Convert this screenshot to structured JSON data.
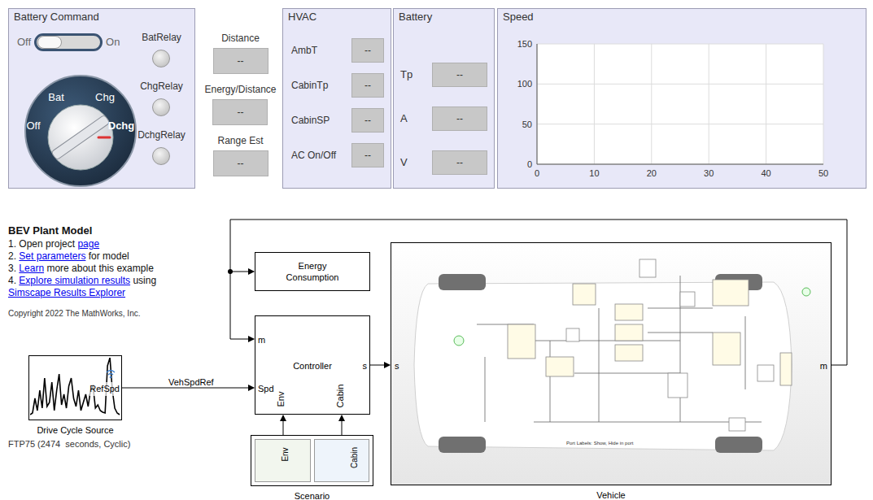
{
  "dashboard": {
    "battery_command": {
      "title": "Battery Command",
      "switch": {
        "off_label": "Off",
        "on_label": "On",
        "on": false
      },
      "knob": [
        {
          "label": "Bat",
          "selected": false
        },
        {
          "label": "Chg",
          "selected": false
        },
        {
          "label": "Off",
          "selected": false
        },
        {
          "label": "Dchg",
          "selected": true
        }
      ],
      "lamps": [
        {
          "label": "BatRelay",
          "on": false
        },
        {
          "label": "ChgRelay",
          "on": false
        },
        {
          "label": "DchgRelay",
          "on": false
        }
      ]
    },
    "readouts": [
      {
        "label": "Distance",
        "value": "--"
      },
      {
        "label": "Energy/Distance",
        "value": "--"
      },
      {
        "label": "Range Est",
        "value": "--"
      }
    ],
    "hvac": {
      "title": "HVAC",
      "rows": [
        {
          "label": "AmbT",
          "value": "--"
        },
        {
          "label": "CabinTp",
          "value": "--"
        },
        {
          "label": "CabinSP",
          "value": "--"
        },
        {
          "label": "AC On/Off",
          "value": "--"
        }
      ]
    },
    "battery": {
      "title": "Battery",
      "rows": [
        {
          "label": "Tp",
          "value": "--"
        },
        {
          "label": "A",
          "value": "--"
        },
        {
          "label": "V",
          "value": "--"
        }
      ]
    },
    "speed": {
      "title": "Speed",
      "y_ticks": [
        "150",
        "100",
        "50",
        "0"
      ],
      "x_ticks": [
        "0",
        "10",
        "20",
        "30",
        "40",
        "50"
      ],
      "series": []
    }
  },
  "diagram": {
    "notes": {
      "title": "BEV Plant Model",
      "steps": [
        {
          "number": "1.",
          "parts": [
            {
              "text": "Open project ",
              "link": false,
              "break_before": false
            },
            {
              "text": "page",
              "link": true,
              "break_before": false
            }
          ]
        },
        {
          "number": "2.",
          "parts": [
            {
              "text": "Set parameters",
              "link": true,
              "break_before": false
            },
            {
              "text": " for model",
              "link": false,
              "break_before": false
            }
          ]
        },
        {
          "number": "3.",
          "parts": [
            {
              "text": "Learn",
              "link": true,
              "break_before": false
            },
            {
              "text": " more about this example",
              "link": false,
              "break_before": false
            }
          ]
        },
        {
          "number": "4.",
          "parts": [
            {
              "text": "Explore simulation results",
              "link": true,
              "break_before": false
            },
            {
              "text": " using",
              "link": false,
              "break_before": false
            },
            {
              "text": "Simscape Results Explorer",
              "link": true,
              "break_before": true
            }
          ]
        }
      ],
      "copyright": "Copyright 2022 The MathWorks, Inc."
    },
    "energy_block": {
      "label": "Energy Consumption"
    },
    "controller": {
      "label": "Controller",
      "port_m": "m",
      "port_spd": "Spd",
      "port_out": "s",
      "port_env": "Env",
      "port_cabin": "Cabin"
    },
    "drive_cycle": {
      "label": "Drive Cycle Source",
      "port": "RefSpd",
      "info": "FTP75 (2474  seconds, Cyclic)"
    },
    "signal_label": "VehSpdRef",
    "scenario": {
      "label": "Scenario",
      "port_env": "Env",
      "port_cabin": "Cabin"
    },
    "vehicle": {
      "label": "Vehicle",
      "port_in": "s",
      "port_out": "m",
      "port_labels_note": "Port Labels: Show, Hide in port"
    }
  }
}
